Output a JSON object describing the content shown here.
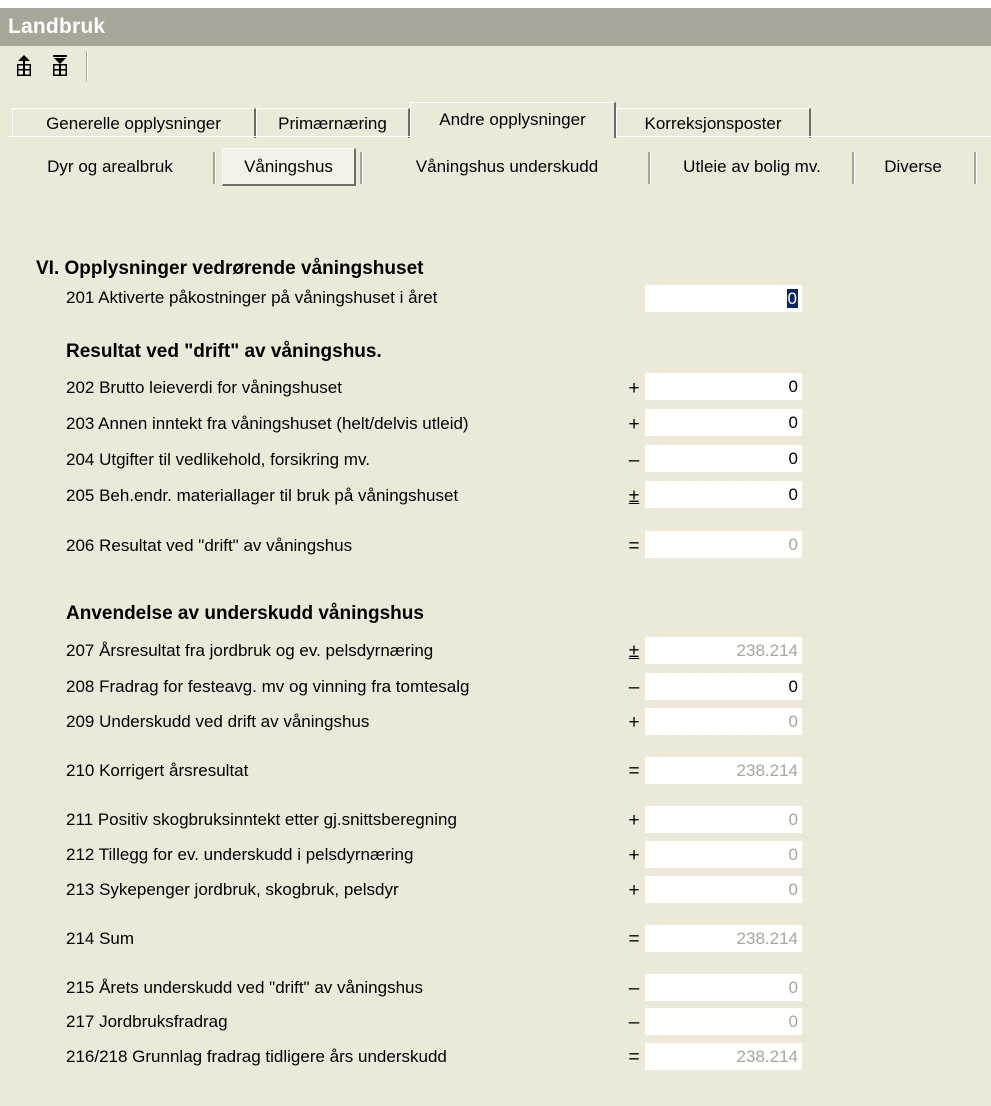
{
  "window": {
    "title": "Landbruk"
  },
  "toolbar": {
    "buttons": [
      "move-up-icon",
      "move-down-icon"
    ]
  },
  "tabs_main": [
    {
      "label": "Generelle opplysninger",
      "active": false
    },
    {
      "label": "Primærnæring",
      "active": false
    },
    {
      "label": "Andre opplysninger",
      "active": true
    },
    {
      "label": "Korreksjonsposter",
      "active": false
    }
  ],
  "tabs_sub": [
    {
      "label": "Dyr og arealbruk",
      "active": false
    },
    {
      "label": "Våningshus",
      "active": true
    },
    {
      "label": "Våningshus underskudd",
      "active": false
    },
    {
      "label": "Utleie av bolig mv.",
      "active": false
    },
    {
      "label": "Diverse",
      "active": false
    }
  ],
  "section_vi": {
    "heading": "VI. Opplysninger vedrørende våningshuset",
    "row_201": {
      "label": "201  Aktiverte påkostninger på våningshuset i året",
      "value": "0"
    }
  },
  "section_drift": {
    "heading": "Resultat ved \"drift\" av våningshus.",
    "rows": [
      {
        "label": "202  Brutto leieverdi for våningshuset",
        "op": "+",
        "value": "0",
        "disabled": false
      },
      {
        "label": "203  Annen inntekt fra våningshuset (helt/delvis utleid)",
        "op": "+",
        "value": "0",
        "disabled": false
      },
      {
        "label": "204  Utgifter til vedlikehold, forsikring mv.",
        "op": "–",
        "value": "0",
        "disabled": false
      },
      {
        "label": "205  Beh.endr. materiallager til bruk på våningshuset",
        "op": "±",
        "value": "0",
        "disabled": false
      },
      {
        "label": "206  Resultat ved \"drift\" av våningshus",
        "op": "=",
        "value": "0",
        "disabled": true
      }
    ]
  },
  "section_anvendelse": {
    "heading": "Anvendelse av underskudd våningshus",
    "rows": [
      {
        "label": "207  Årsresultat fra jordbruk og ev. pelsdyrnæring",
        "op": "±",
        "value": "238.214",
        "disabled": true
      },
      {
        "label": "208  Fradrag for festeavg. mv og vinning fra tomtesalg",
        "op": "–",
        "value": "0",
        "disabled": false
      },
      {
        "label": "209  Underskudd ved drift av våningshus",
        "op": "+",
        "value": "0",
        "disabled": true
      },
      {
        "label": "210  Korrigert årsresultat",
        "op": "=",
        "value": "238.214",
        "disabled": true
      },
      {
        "label": "211  Positiv skogbruksinntekt etter gj.snittsberegning",
        "op": "+",
        "value": "0",
        "disabled": true
      },
      {
        "label": "212  Tillegg for ev. underskudd i pelsdyrnæring",
        "op": "+",
        "value": "0",
        "disabled": true
      },
      {
        "label": "213  Sykepenger jordbruk, skogbruk, pelsdyr",
        "op": "+",
        "value": "0",
        "disabled": true
      },
      {
        "label": "214  Sum",
        "op": "=",
        "value": "238.214",
        "disabled": true
      },
      {
        "label": "215  Årets underskudd ved \"drift\" av våningshus",
        "op": "–",
        "value": "0",
        "disabled": true
      },
      {
        "label": "217  Jordbruksfradrag",
        "op": "–",
        "value": "0",
        "disabled": true
      },
      {
        "label": "216/218  Grunnlag fradrag tidligere års underskudd",
        "op": "=",
        "value": "238.214",
        "disabled": true
      }
    ]
  }
}
